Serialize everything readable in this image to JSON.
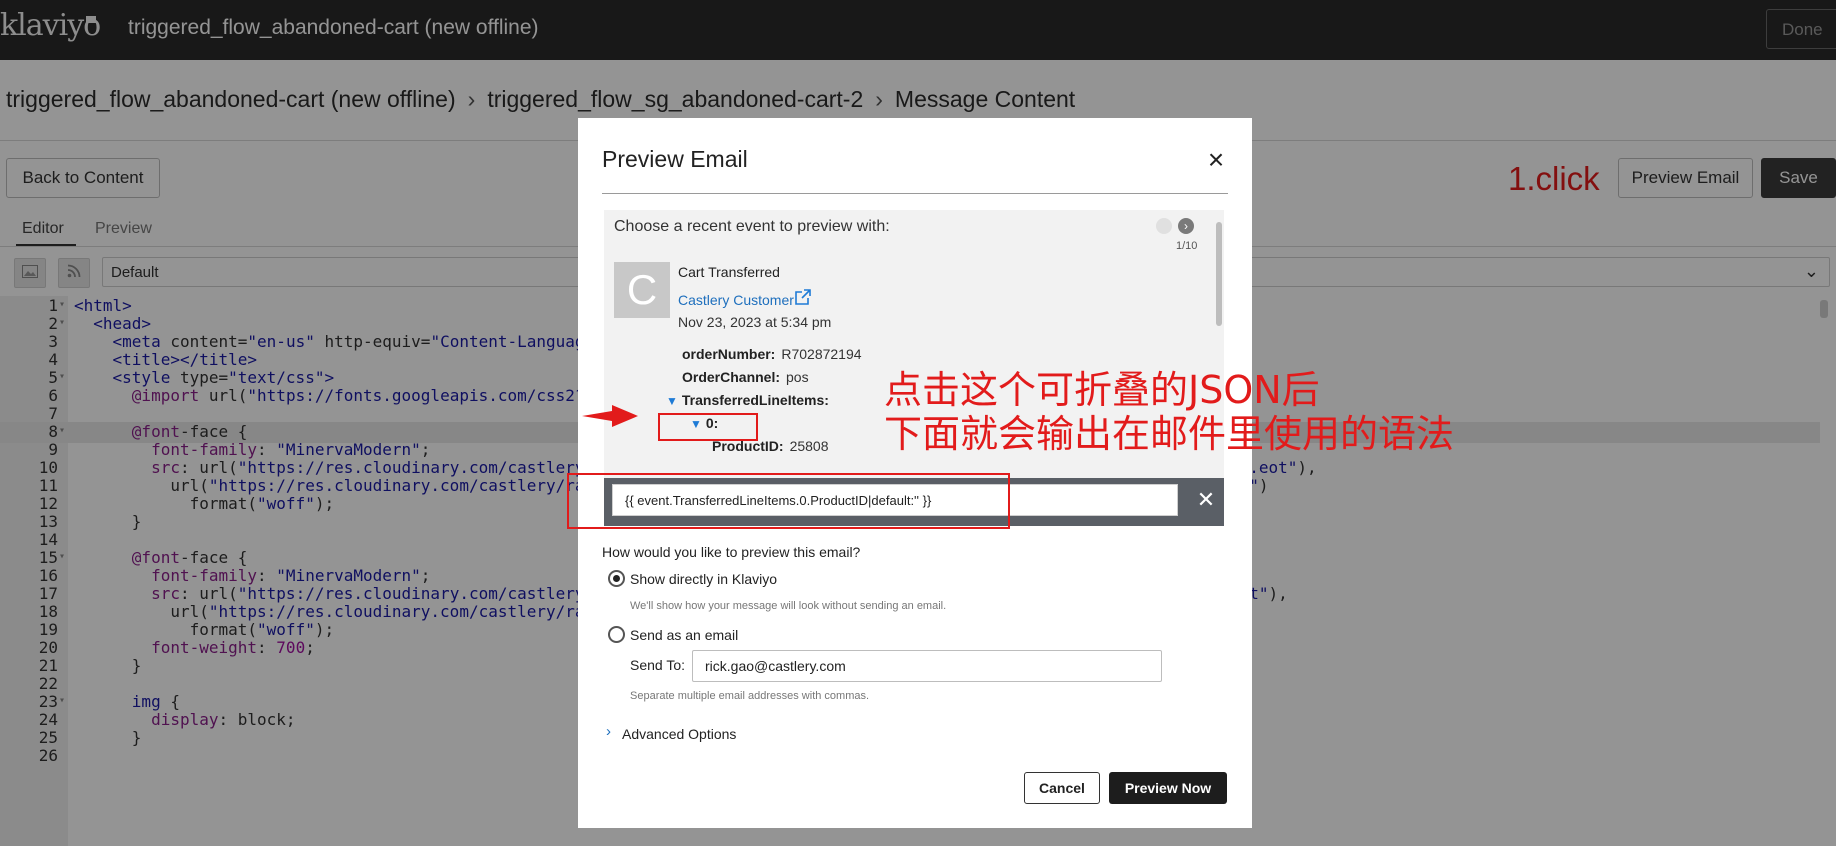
{
  "app": {
    "logo": "klaviyo",
    "title": "triggered_flow_abandoned-cart (new offline)",
    "done_label": "Done"
  },
  "breadcrumb": [
    "triggered_flow_abandoned-cart (new offline)",
    "triggered_flow_sg_abandoned-cart-2",
    "Message Content"
  ],
  "toolbar": {
    "back_label": "Back to Content",
    "preview_label": "Preview Email",
    "save_label": "Save"
  },
  "tabs": [
    {
      "label": "Editor"
    },
    {
      "label": "Preview"
    }
  ],
  "template_select": {
    "value": "Default"
  },
  "code_lines": [
    {
      "n": "1",
      "fold": true,
      "html": "<span class='c-tag'>&lt;html&gt;</span>"
    },
    {
      "n": "2",
      "fold": true,
      "html": "  <span class='c-tag'>&lt;head&gt;</span>"
    },
    {
      "n": "3",
      "fold": false,
      "html": "    <span class='c-tag'>&lt;meta</span> content=<span class='c-str'>\"en-us\"</span> http-equiv=<span class='c-str'>\"Content-Languag</span>"
    },
    {
      "n": "4",
      "fold": false,
      "html": "    <span class='c-tag'>&lt;title&gt;&lt;/title&gt;</span>"
    },
    {
      "n": "5",
      "fold": true,
      "html": "    <span class='c-tag'>&lt;style</span> type=<span class='c-str'>\"text/css\"</span><span class='c-tag'>&gt;</span>"
    },
    {
      "n": "6",
      "fold": false,
      "html": "      <span class='c-key'>@import</span> url(<span class='c-str'>\"https://fonts.googleapis.com/css2?</span>"
    },
    {
      "n": "7",
      "fold": false,
      "html": ""
    },
    {
      "n": "8",
      "fold": true,
      "hl": true,
      "html": "      <span class='c-key'>@font</span>-face {"
    },
    {
      "n": "9",
      "fold": false,
      "html": "        <span class='c-key'>font-family</span>: <span class='c-str'>\"MinervaModern\"</span>;"
    },
    {
      "n": "10",
      "fold": false,
      "html": "        <span class='c-key'>src</span>: url(<span class='c-str'>\"https://res.cloudinary.com/castlery</span>                                                                 <span class='c-str'>ular.eot\"</span>),"
    },
    {
      "n": "11",
      "fold": false,
      "html": "          url(<span class='c-str'>\"https://res.cloudinary.com/castlery/ra</span>                                                               <span class='c-str'>r.woff\"</span>)"
    },
    {
      "n": "12",
      "fold": false,
      "html": "            format(<span class='c-str'>\"woff\"</span>);"
    },
    {
      "n": "13",
      "fold": false,
      "html": "      }"
    },
    {
      "n": "14",
      "fold": false,
      "html": ""
    },
    {
      "n": "15",
      "fold": true,
      "html": "      <span class='c-key'>@font</span>-face {"
    },
    {
      "n": "16",
      "fold": false,
      "html": "        <span class='c-key'>font-family</span>: <span class='c-str'>\"MinervaModern\"</span>;"
    },
    {
      "n": "17",
      "fold": false,
      "html": "        <span class='c-key'>src</span>: url(<span class='c-str'>\"https://res.cloudinary.com/castlery</span>                                                                 <span class='c-str'>d.eot\"</span>),"
    },
    {
      "n": "18",
      "fold": false,
      "html": "          url(<span class='c-str'>\"https://res.cloudinary.com/castlery/ra</span>                                                               <span class='c-str'>off\"</span>)"
    },
    {
      "n": "19",
      "fold": false,
      "html": "            format(<span class='c-str'>\"woff\"</span>);"
    },
    {
      "n": "20",
      "fold": false,
      "html": "        <span class='c-key'>font-weight</span>: <span class='c-num'>700</span>;"
    },
    {
      "n": "21",
      "fold": false,
      "html": "      }"
    },
    {
      "n": "22",
      "fold": false,
      "html": ""
    },
    {
      "n": "23",
      "fold": true,
      "html": "      <span class='c-tag'>img</span> {"
    },
    {
      "n": "24",
      "fold": false,
      "html": "        <span class='c-key'>display</span>: block;"
    },
    {
      "n": "25",
      "fold": false,
      "html": "      }"
    },
    {
      "n": "26",
      "fold": false,
      "html": ""
    }
  ],
  "modal": {
    "title": "Preview Email",
    "choose_label": "Choose a recent event to preview with:",
    "counter": "1/10",
    "event": {
      "avatar_letter": "C",
      "name": "Cart Transferred",
      "customer": "Castlery Customer",
      "date": "Nov 23, 2023 at 5:34 pm",
      "order_number_key": "orderNumber:",
      "order_number_val": "R702872194",
      "order_channel_key": "OrderChannel:",
      "order_channel_val": "pos",
      "line_items_key": "TransferredLineItems:",
      "index_key": "0:",
      "product_id_key": "ProductID:",
      "product_id_val": "25808"
    },
    "syntax_value": "{{ event.TransferredLineItems.0.ProductID|default:'' }}",
    "how_label": "How would you like to preview this email?",
    "opt_klaviyo": "Show directly in Klaviyo",
    "opt_klaviyo_hint": "We'll show how your message will look without sending an email.",
    "opt_email": "Send as an email",
    "send_to_label": "Send To:",
    "send_to_value": "rick.gao@castlery.com",
    "send_to_hint": "Separate multiple email addresses with commas.",
    "advanced_label": "Advanced Options",
    "cancel_label": "Cancel",
    "preview_now_label": "Preview Now"
  },
  "annotations": {
    "step_label": "1.click",
    "note_line1": "点击这个可折叠的JSON后",
    "note_line2": "下面就会输出在邮件里使用的语法"
  },
  "colors": {
    "topbar": "#2a2a2a",
    "accent_red": "#e21b1b",
    "link_blue": "#1e6fbd",
    "primary_button": "#1d1d1d"
  }
}
